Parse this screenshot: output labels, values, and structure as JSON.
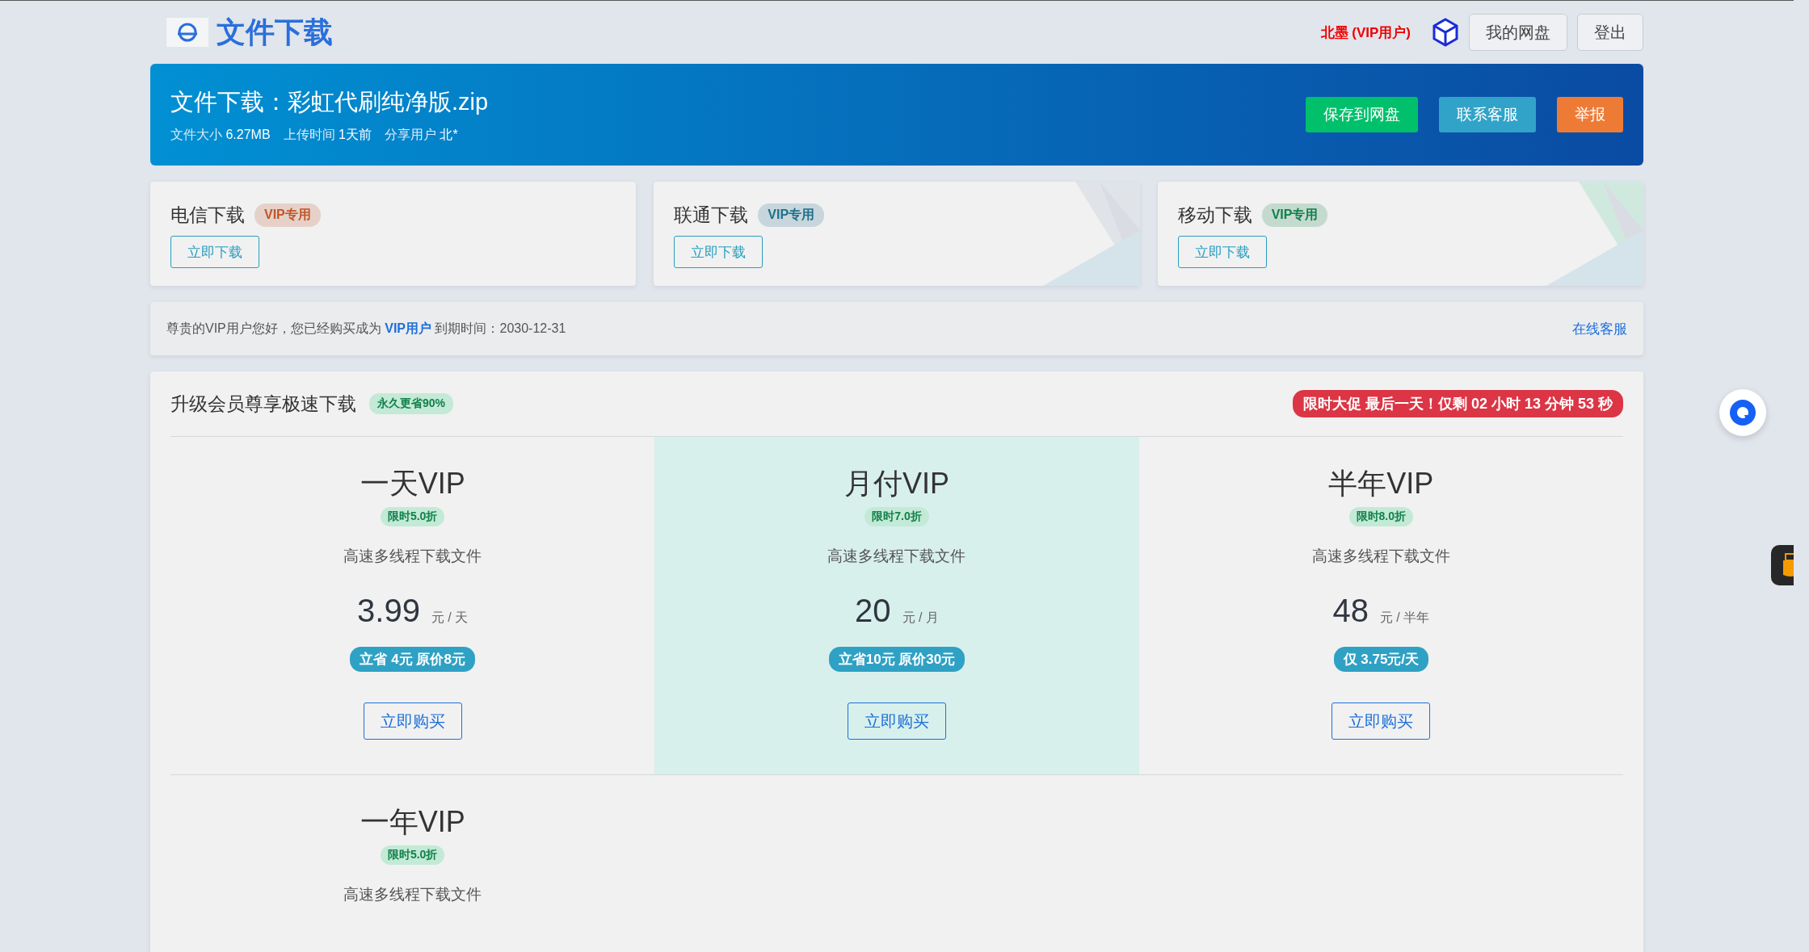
{
  "header": {
    "title": "文件下载",
    "user": "北墨 (VIP用户)",
    "buttons": [
      "我的网盘",
      "登出"
    ]
  },
  "file": {
    "title": "文件下载：彩虹代刷纯净版.zip",
    "meta": [
      {
        "label": "文件大小",
        "value": "6.27MB"
      },
      {
        "label": "上传时间",
        "value": "1天前"
      },
      {
        "label": "分享用户",
        "value": "北*"
      }
    ],
    "actions": [
      {
        "label": "保存到网盘",
        "color": "#00c06b"
      },
      {
        "label": "联系客服",
        "color": "#31a3c8"
      },
      {
        "label": "举报",
        "color": "#ee7b35"
      }
    ]
  },
  "download_cards": [
    {
      "title": "电信下载",
      "badge": "VIP专用",
      "color": "#c0562a",
      "kind": "plain",
      "button": "立即下载"
    },
    {
      "title": "联通下载",
      "badge": "VIP专用",
      "color": "#1f6f8b",
      "kind": "pattern",
      "button": "立即下载"
    },
    {
      "title": "移动下载",
      "badge": "VIP专用",
      "color": "#12804c",
      "kind": "pattern",
      "button": "立即下载"
    }
  ],
  "notice": {
    "text": "尊贵的VIP用户您好，您已经购买成为 **VIP用户** 到期时间：2030-12-31",
    "link": "在线客服"
  },
  "upgrade": {
    "title": "升级会员尊享极速下载",
    "badge": "永久更省90%",
    "promo": "限时大促 最后一天！仅剩 02 小时 13 分钟 53 秒",
    "plans": [
      {
        "name": "一天VIP",
        "discount": "限时5.0折",
        "desc": "高速多线程下载文件",
        "price": "3.99",
        "unit": "元 / 天",
        "saving": "立省 4元 原价8元",
        "button": "立即购买",
        "selected": false
      },
      {
        "name": "月付VIP",
        "discount": "限时7.0折",
        "desc": "高速多线程下载文件",
        "price": "20",
        "unit": "元 / 月",
        "saving": "立省10元 原价30元",
        "button": "立即购买",
        "selected": true
      },
      {
        "name": "半年VIP",
        "discount": "限时8.0折",
        "desc": "高速多线程下载文件",
        "price": "48",
        "unit": "元 / 半年",
        "saving": "仅 3.75元/天",
        "button": "立即购买",
        "selected": false
      },
      {
        "name": "一年VIP",
        "discount": "限时5.0折",
        "desc": "高速多线程下载文件",
        "selected": false
      }
    ]
  }
}
